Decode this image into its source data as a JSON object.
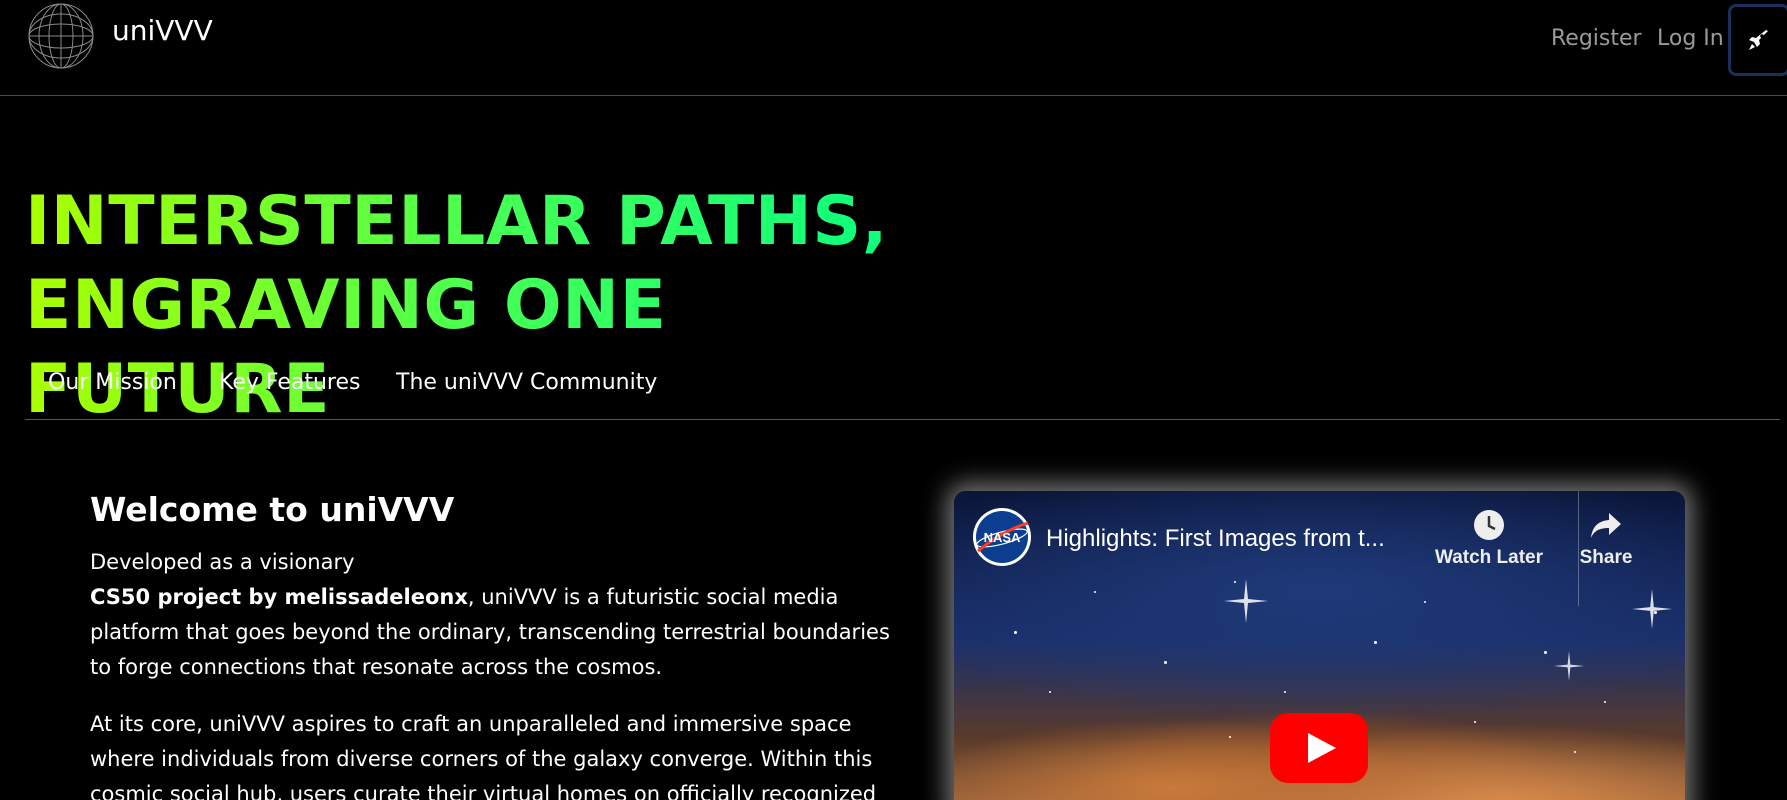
{
  "header": {
    "brand": "uniVVV",
    "register_label": "Register",
    "login_label": "Log In",
    "theme_toggle_icon": "rocket-icon"
  },
  "hero": {
    "line1": "INTERSTELLAR PATHS,",
    "line2": "ENGRAVING ONE FUTURE",
    "gradient_colors": [
      "#aaff00",
      "#00ff88"
    ]
  },
  "tabs": [
    {
      "label": "Our Mission"
    },
    {
      "label": "Key Features"
    },
    {
      "label": "The uniVVV Community"
    }
  ],
  "content": {
    "heading": "Welcome to uniVVV",
    "p1_lead": "Developed as a visionary",
    "p1_bold": "CS50 project by melissadeleonx",
    "p1_rest": ", uniVVV is a futuristic social media platform that goes beyond the ordinary, transcending terrestrial boundaries to forge connections that resonate across the cosmos.",
    "p2": "At its core, uniVVV aspires to craft an unparalleled and immersive space where individuals from diverse corners of the galaxy converge. Within this cosmic social hub, users curate their virtual homes on officially recognized"
  },
  "video": {
    "channel_logo": "nasa-logo",
    "title": "Highlights: First Images from t...",
    "watch_later_label": "Watch Later",
    "share_label": "Share",
    "play_icon": "youtube-play-icon"
  }
}
